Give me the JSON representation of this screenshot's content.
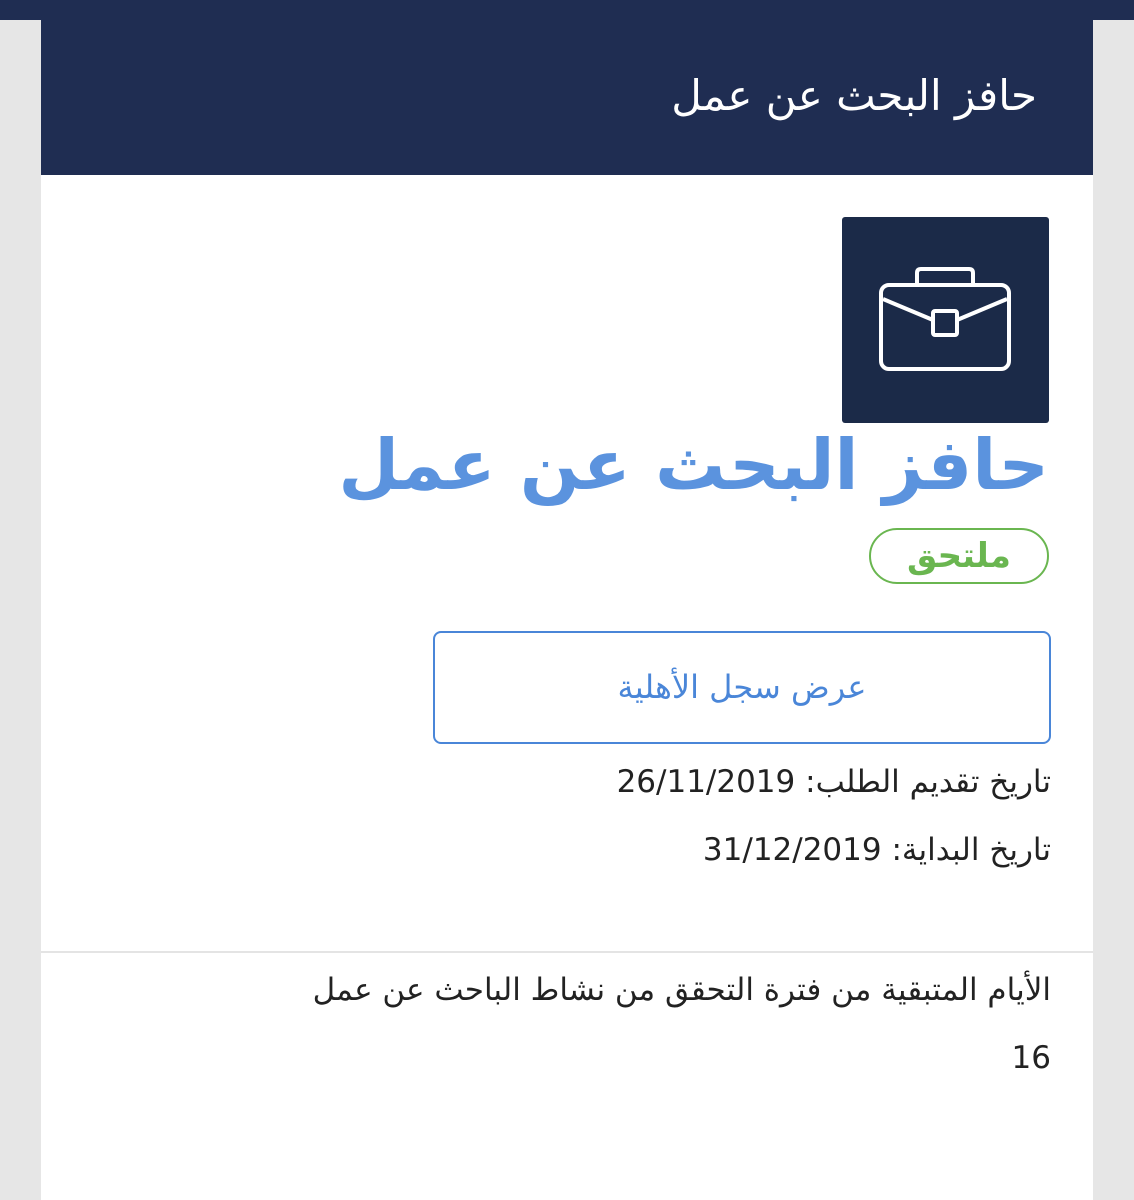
{
  "header": {
    "title": "حافز البحث عن عمل"
  },
  "service": {
    "icon": "briefcase-icon",
    "title": "حافز البحث عن عمل",
    "status": "ملتحق"
  },
  "actions": {
    "eligibility_record_label": "عرض سجل الأهلية"
  },
  "details": {
    "submit_date_label": "تاريخ تقديم الطلب:",
    "submit_date": "26/11/2019",
    "start_date_label": "تاريخ البداية:",
    "start_date": "31/12/2019"
  },
  "verification": {
    "remaining_days_label": "الأيام المتبقية من فترة التحقق من نشاط الباحث عن عمل",
    "remaining_days": "16"
  },
  "colors": {
    "header_bg": "#1f2d52",
    "icon_tile_bg": "#1b2a48",
    "title_blue": "#5b93de",
    "status_green": "#6ab650",
    "button_blue": "#4a86d8"
  }
}
